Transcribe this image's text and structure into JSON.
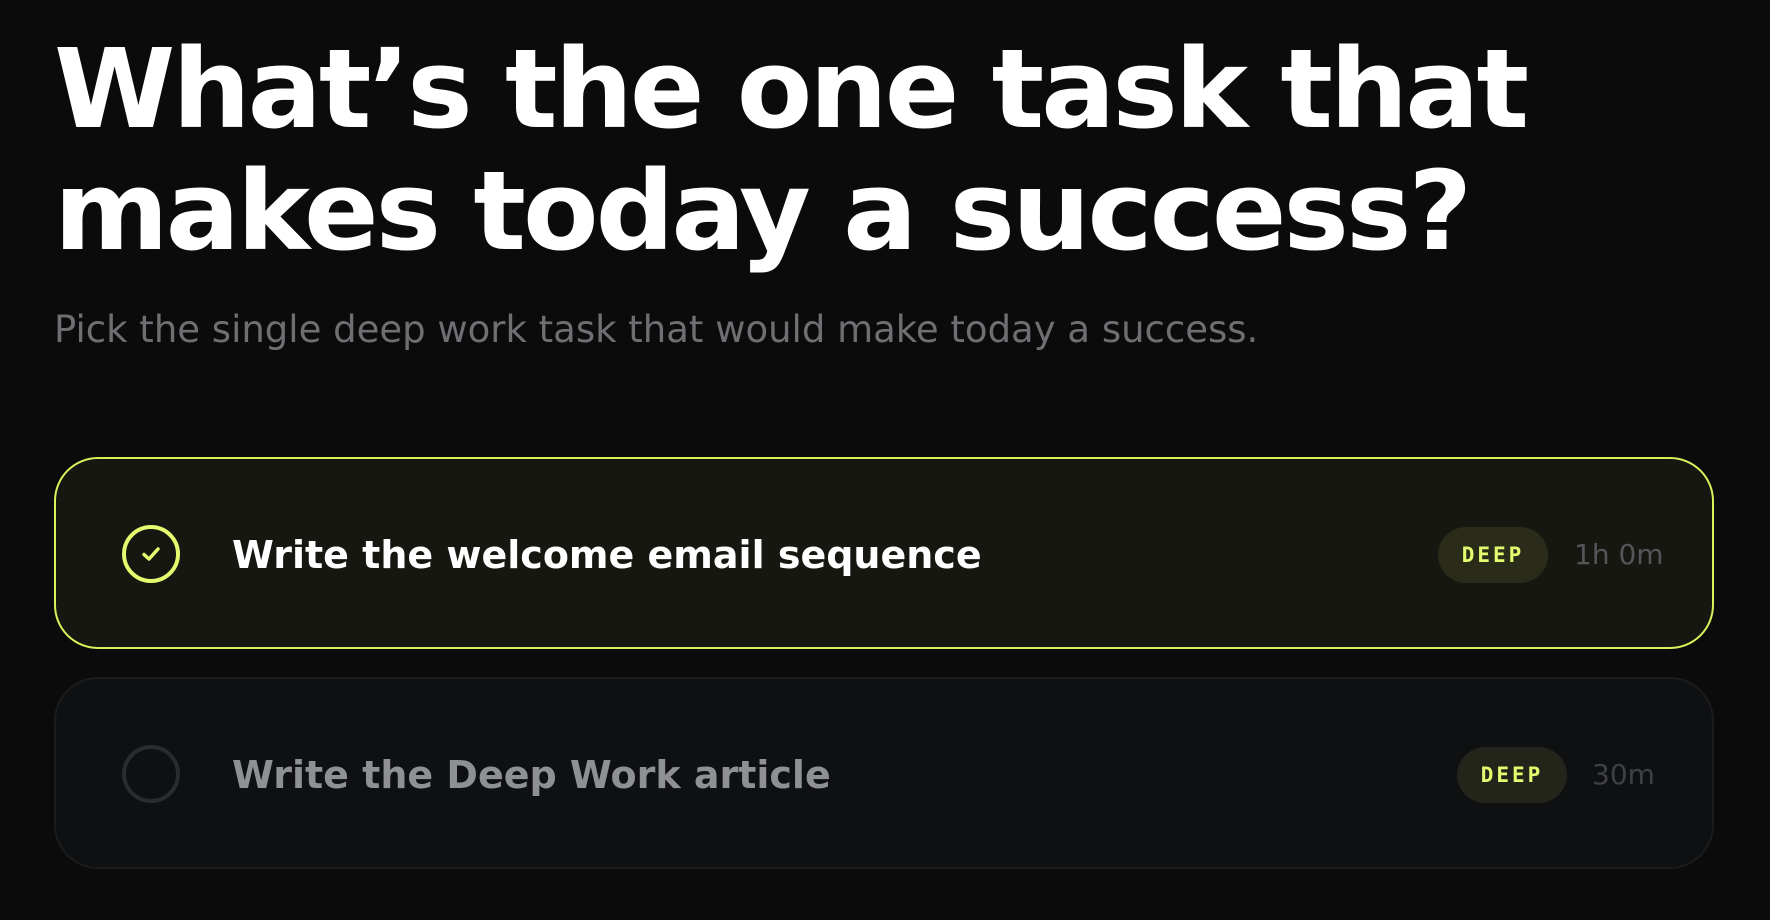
{
  "header": {
    "title_line_1": "What’s the one task that",
    "title_line_2": "makes today a success?",
    "subtitle": "Pick the single deep work task that would make today a success."
  },
  "tasks": [
    {
      "title": "Write the welcome email sequence",
      "badge": "DEEP",
      "duration": "1h 0m",
      "selected": true,
      "icon": "check-circle-icon"
    },
    {
      "title": "Write the Deep Work article",
      "badge": "DEEP",
      "duration": "30m",
      "selected": false,
      "icon": "empty-circle-icon"
    }
  ],
  "colors": {
    "background": "#0b0b0c",
    "accent": "#e3fb6e",
    "muted_text": "#6e6f72",
    "selected_card_bg": "#161710",
    "unselected_card_bg": "#0f1011"
  }
}
